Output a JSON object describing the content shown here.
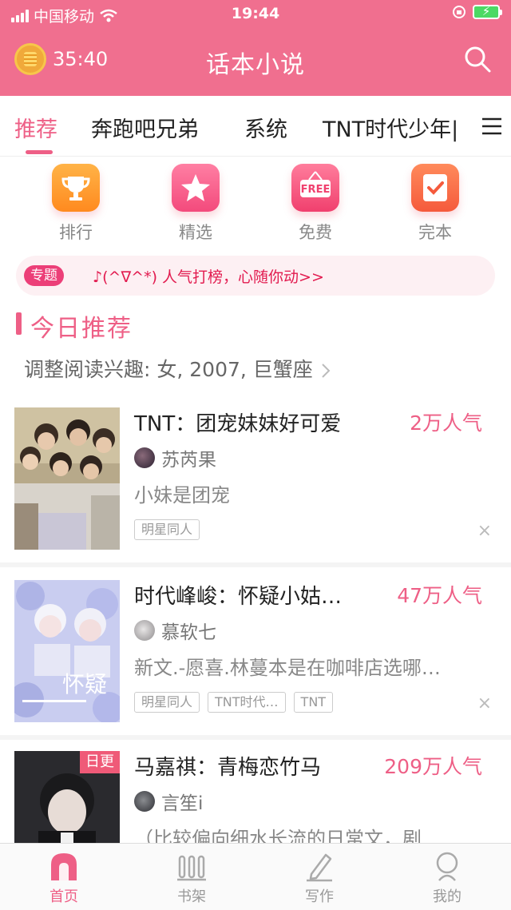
{
  "status": {
    "carrier": "中国移动",
    "time": "19:44",
    "battery": "⚡"
  },
  "header": {
    "timer": "35:40",
    "title": "话本小说"
  },
  "tabs": [
    {
      "label": "推荐"
    },
    {
      "label": "奔跑吧兄弟"
    },
    {
      "label": "系统"
    },
    {
      "label": "TNT时代少年|"
    }
  ],
  "quick_nav": [
    {
      "label": "排行",
      "icon": "trophy-icon"
    },
    {
      "label": "精选",
      "icon": "star-icon"
    },
    {
      "label": "免费",
      "icon": "free-icon",
      "badge": "FREE"
    },
    {
      "label": "完本",
      "icon": "check-icon"
    }
  ],
  "banner": {
    "tag": "专题",
    "text": "♪(^∇^*) 人气打榜，心随你动>>"
  },
  "section": {
    "title": "今日推荐",
    "interest": "调整阅读兴趣: 女, 2007, 巨蟹座"
  },
  "books": [
    {
      "title": "TNT：团宠妹妹好可爱",
      "popularity": "2万人气",
      "author": "苏芮果",
      "desc": "小妹是团宠",
      "tags": [
        "明星同人"
      ],
      "close": "×"
    },
    {
      "title": "时代峰峻：怀疑小姑…",
      "popularity": "47万人气",
      "author": "慕软七",
      "desc": "新文.-愿喜.林蔓本是在咖啡店选哪…",
      "tags": [
        "明星同人",
        "TNT时代…",
        "TNT"
      ],
      "close": "×"
    },
    {
      "title": "马嘉祺：青梅恋竹马",
      "popularity": "209万人气",
      "author": "言笙i",
      "desc": "（比较偏向细水长流的日常文，剧",
      "badge": "日更"
    }
  ],
  "bottom_nav": [
    {
      "label": "首页",
      "icon": "home-icon"
    },
    {
      "label": "书架",
      "icon": "bookshelf-icon"
    },
    {
      "label": "写作",
      "icon": "pen-icon"
    },
    {
      "label": "我的",
      "icon": "profile-icon"
    }
  ],
  "colors": {
    "brand": "#f06f8f",
    "accent": "#ee5f86"
  }
}
